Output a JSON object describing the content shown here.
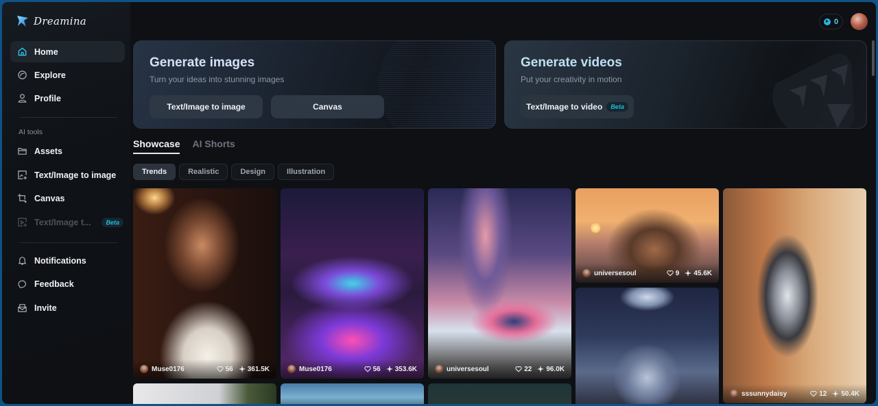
{
  "app": {
    "name": "Dreamina"
  },
  "sidebar": {
    "main_items": [
      {
        "label": "Home",
        "icon": "home-icon",
        "active": true
      },
      {
        "label": "Explore",
        "icon": "explore-icon",
        "active": false
      },
      {
        "label": "Profile",
        "icon": "profile-icon",
        "active": false
      }
    ],
    "section_label": "AI tools",
    "tool_items": [
      {
        "label": "Assets",
        "icon": "folder-icon"
      },
      {
        "label": "Text/Image to image",
        "icon": "image-generate-icon"
      },
      {
        "label": "Canvas",
        "icon": "canvas-crop-icon"
      },
      {
        "label": "Text/Image t...",
        "icon": "video-generate-icon",
        "badge": "Beta",
        "disabled": true
      }
    ],
    "bottom_items": [
      {
        "label": "Notifications",
        "icon": "bell-icon"
      },
      {
        "label": "Feedback",
        "icon": "feedback-icon"
      },
      {
        "label": "Invite",
        "icon": "invite-icon"
      }
    ]
  },
  "header": {
    "credits": "0"
  },
  "hero": {
    "images": {
      "title": "Generate images",
      "subtitle": "Turn your ideas into stunning images",
      "buttons": [
        "Text/Image to image",
        "Canvas"
      ]
    },
    "videos": {
      "title": "Generate videos",
      "subtitle": "Put your creativity in motion",
      "button": "Text/Image to video",
      "badge": "Beta"
    }
  },
  "tabs": [
    {
      "label": "Showcase",
      "active": true
    },
    {
      "label": "AI Shorts",
      "active": false
    }
  ],
  "filters": [
    {
      "label": "Trends",
      "active": true
    },
    {
      "label": "Realistic",
      "active": false
    },
    {
      "label": "Design",
      "active": false
    },
    {
      "label": "Illustration",
      "active": false
    }
  ],
  "gallery": [
    {
      "author": "Muse0176",
      "likes": "56",
      "uses": "361.5K",
      "subject": "woman in white dress"
    },
    {
      "author": "Muse0176",
      "likes": "56",
      "uses": "353.6K",
      "subject": "neon sports car"
    },
    {
      "author": "universesoul",
      "likes": "22",
      "uses": "96.0K",
      "subject": "train under milky way"
    },
    {
      "author": "universesoul",
      "likes": "9",
      "uses": "45.6K",
      "subject": "woman at sunset"
    },
    {
      "author": "sssunnydaisy",
      "likes": "12",
      "uses": "50.4K",
      "subject": "chrome robot on street"
    }
  ],
  "colors": {
    "accent": "#2bb6d8",
    "background": "#0e1014",
    "frame": "#0f5386"
  }
}
